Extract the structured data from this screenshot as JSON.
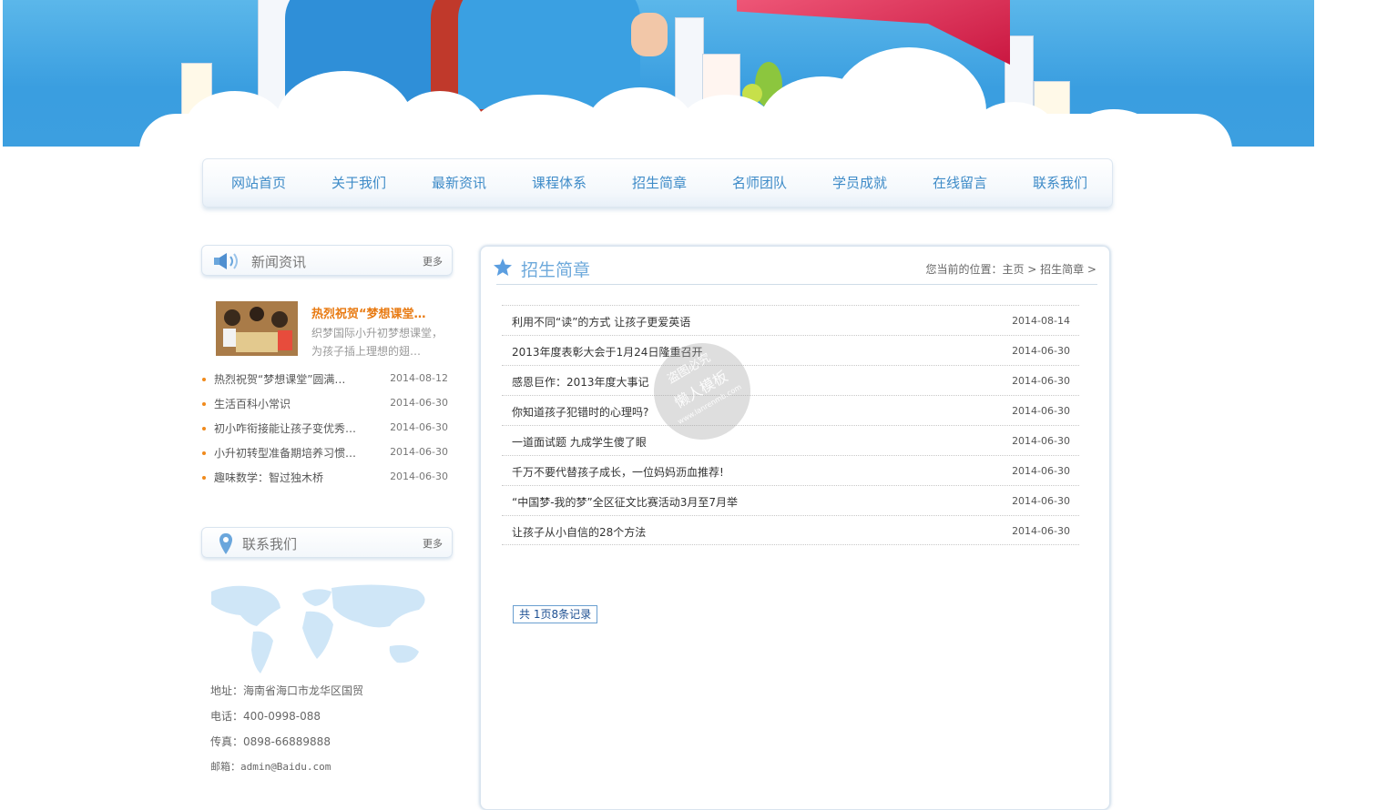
{
  "nav": [
    "网站首页",
    "关于我们",
    "最新资讯",
    "课程体系",
    "招生简章",
    "名师团队",
    "学员成就",
    "在线留言",
    "联系我们"
  ],
  "news_box": {
    "title": "新闻资讯",
    "more": "更多",
    "featured": {
      "title": "热烈祝贺“梦想课堂…",
      "desc": "织梦国际小升初梦想课堂，为孩子插上理想的翅…"
    },
    "items": [
      {
        "title": "热烈祝贺“梦想课堂”圆满…",
        "date": "2014-08-12"
      },
      {
        "title": "生活百科小常识",
        "date": "2014-06-30"
      },
      {
        "title": "初小咋衔接能让孩子变优秀…",
        "date": "2014-06-30"
      },
      {
        "title": "小升初转型准备期培养习惯…",
        "date": "2014-06-30"
      },
      {
        "title": "趣味数学：智过独木桥",
        "date": "2014-06-30"
      }
    ]
  },
  "contact_box": {
    "title": "联系我们",
    "more": "更多",
    "address": "地址：海南省海口市龙华区国贸",
    "phone": "电话：400-0998-088",
    "fax": "传真：0898-66889888",
    "email": "邮箱：admin@Baidu.com"
  },
  "main": {
    "title": "招生简章",
    "breadcrumb": "您当前的位置：主页 > 招生简章 >",
    "rows": [
      {
        "title": "利用不同“读”的方式 让孩子更爱英语",
        "date": "2014-08-14"
      },
      {
        "title": "2013年度表彰大会于1月24日隆重召开",
        "date": "2014-06-30"
      },
      {
        "title": "感恩巨作：2013年度大事记",
        "date": "2014-06-30"
      },
      {
        "title": "你知道孩子犯错时的心理吗?",
        "date": "2014-06-30"
      },
      {
        "title": "一道面试题 九成学生傻了眼",
        "date": "2014-06-30"
      },
      {
        "title": "千万不要代替孩子成长，一位妈妈沥血推荐!",
        "date": "2014-06-30"
      },
      {
        "title": "“中国梦-我的梦”全区征文比赛活动3月至7月举",
        "date": "2014-06-30"
      },
      {
        "title": "让孩子从小自信的28个方法",
        "date": "2014-06-30"
      }
    ],
    "pager": "共 1页8条记录"
  },
  "watermark": {
    "line1": "盗图必究",
    "line2": "懒人模板",
    "line3": "www.lanrenmb.com"
  },
  "colors": {
    "nav_text": "#3e8bc8",
    "feature_title": "#e87a12",
    "bullet": "#f08a1c",
    "title_blue": "#6da9db"
  }
}
